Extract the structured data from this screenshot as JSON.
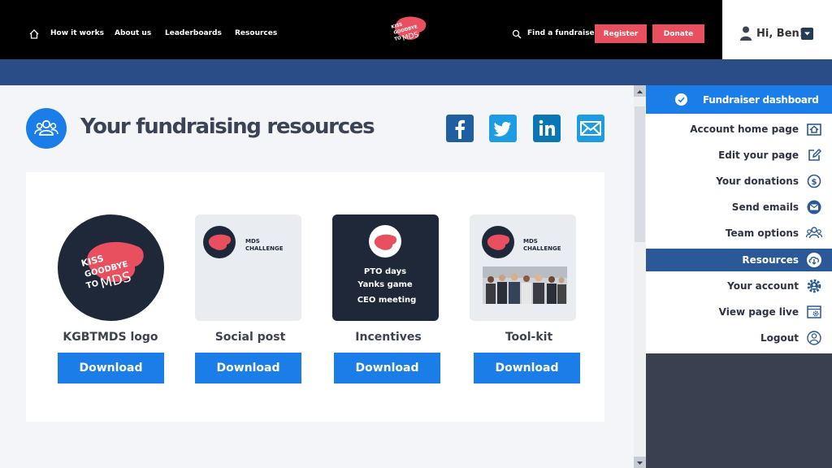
{
  "nav": {
    "how_it_works": "How it works",
    "about_us": "About us",
    "leaderboards": "Leaderboards",
    "resources": "Resources",
    "find_fundraiser": "Find a fundraiser",
    "register": "Register",
    "donate": "Donate"
  },
  "user": {
    "greeting": "Hi, Ben!"
  },
  "logo": {
    "line1": "KISS",
    "line2": "GOODBYE",
    "line3": "TO",
    "line4": "MDS"
  },
  "main": {
    "title": "Your fundraising resources"
  },
  "tiles": {
    "mds_line1": "MDS",
    "mds_line2": "CHALLENGE",
    "incentive_1": "PTO days",
    "incentive_2": "Yanks game",
    "incentive_3": "CEO meeting"
  },
  "resources": [
    {
      "label": "KGBTMDS logo",
      "button": "Download"
    },
    {
      "label": "Social post",
      "button": "Download"
    },
    {
      "label": "Incentives",
      "button": "Download"
    },
    {
      "label": "Tool-kit",
      "button": "Download"
    }
  ],
  "sidebar": {
    "title": "Fundraiser dashboard",
    "items": [
      {
        "label": "Account home page",
        "icon": "home-icon"
      },
      {
        "label": "Edit your page",
        "icon": "edit-icon"
      },
      {
        "label": "Your donations",
        "icon": "dollar-icon"
      },
      {
        "label": "Send emails",
        "icon": "mail-icon"
      },
      {
        "label": "Team options",
        "icon": "team-icon"
      },
      {
        "label": "Resources",
        "icon": "cloud-download-icon",
        "active": true
      },
      {
        "label": "Your account",
        "icon": "gear-icon"
      },
      {
        "label": "View page live",
        "icon": "browser-gear-icon"
      },
      {
        "label": "Logout",
        "icon": "logout-icon"
      }
    ]
  },
  "colors": {
    "brand_blue": "#1a7de8",
    "nav_red": "#e8505f",
    "navy": "#2a4d87",
    "dark_tile": "#1f2838"
  }
}
